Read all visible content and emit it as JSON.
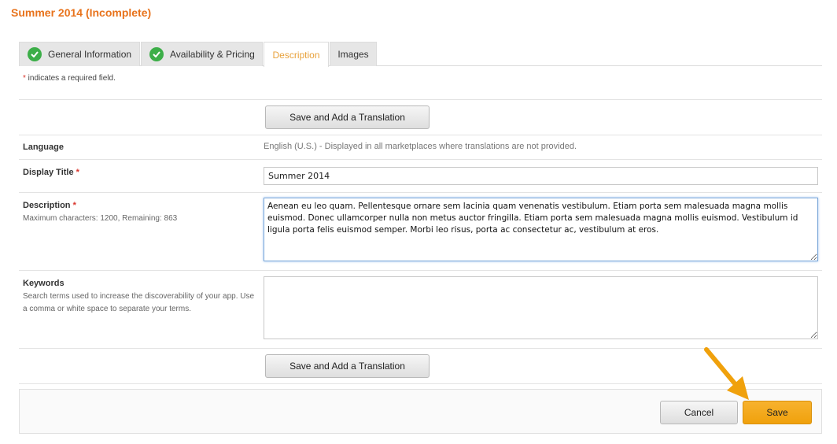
{
  "page": {
    "title": "Summer 2014 (Incomplete)"
  },
  "tabs": [
    {
      "label": "General Information",
      "complete": true
    },
    {
      "label": "Availability & Pricing",
      "complete": true
    },
    {
      "label": "Description",
      "active": true
    },
    {
      "label": "Images"
    }
  ],
  "required_note": {
    "star": "*",
    "text": " indicates a required field."
  },
  "translate_button_label": "Save and Add a Translation",
  "fields": {
    "language": {
      "label": "Language",
      "value": "English (U.S.) - Displayed in all marketplaces where translations are not provided."
    },
    "display_title": {
      "label": "Display Title",
      "star": "*",
      "value": "Summer 2014"
    },
    "description": {
      "label": "Description",
      "star": "*",
      "help": "Maximum characters: 1200, Remaining: 863",
      "value": "Aenean eu leo quam. Pellentesque ornare sem lacinia quam venenatis vestibulum. Etiam porta sem malesuada magna mollis euismod. Donec ullamcorper nulla non metus auctor fringilla. Etiam porta sem malesuada magna mollis euismod. Vestibulum id ligula porta felis euismod semper. Morbi leo risus, porta ac consectetur ac, vestibulum at eros."
    },
    "keywords": {
      "label": "Keywords",
      "help": "Search terms used to increase the discoverability of your app. Use a comma or white space to separate your terms.",
      "value": ""
    }
  },
  "footer": {
    "cancel_label": "Cancel",
    "save_label": "Save"
  },
  "colors": {
    "title": "#e8731c",
    "active_tab": "#e8a23c",
    "check": "#3cae48",
    "save_button": "#f0a10c",
    "arrow": "#f0a10c",
    "required_star": "#d9342b"
  },
  "icons": {
    "tab_complete": "check-circle-icon",
    "pointer": "arrow-pointer-icon"
  }
}
